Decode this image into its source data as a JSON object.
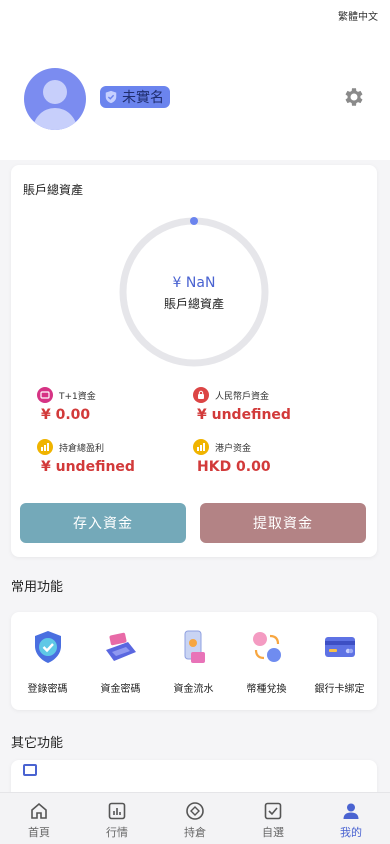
{
  "lang_switch": "繁體中文",
  "profile": {
    "verify_status": "未實名"
  },
  "assets": {
    "title": "賬戶總資產",
    "total_amount": "¥ NaN",
    "total_label": "賬戶總資產",
    "stats": [
      {
        "label": "T+1資金",
        "value": "¥ 0.00",
        "color": "#d63384"
      },
      {
        "label": "人民幣戶資金",
        "value": "¥ undefined",
        "color": "#dc4545"
      },
      {
        "label": "持倉總盈利",
        "value": "¥ undefined",
        "color": "#f0b400"
      },
      {
        "label": "港户资金",
        "value": "HKD 0.00",
        "color": "#f0b400"
      }
    ],
    "deposit_label": "存入資金",
    "withdraw_label": "提取資金"
  },
  "common_functions": {
    "title": "常用功能",
    "items": [
      {
        "label": "登錄密碼",
        "icon": "shield-check-icon"
      },
      {
        "label": "資金密碼",
        "icon": "card-terminal-icon"
      },
      {
        "label": "資金流水",
        "icon": "phone-wallet-icon"
      },
      {
        "label": "幣種兌換",
        "icon": "currency-exchange-icon"
      },
      {
        "label": "銀行卡綁定",
        "icon": "bank-card-icon"
      }
    ]
  },
  "other_functions": {
    "title": "其它功能"
  },
  "tabbar": {
    "items": [
      {
        "label": "首頁",
        "icon": "home-icon"
      },
      {
        "label": "行情",
        "icon": "chart-icon"
      },
      {
        "label": "持倉",
        "icon": "position-icon"
      },
      {
        "label": "自選",
        "icon": "checkbox-icon"
      },
      {
        "label": "我的",
        "icon": "user-icon"
      }
    ],
    "active_index": 4,
    "active_color": "#4a63d1"
  }
}
